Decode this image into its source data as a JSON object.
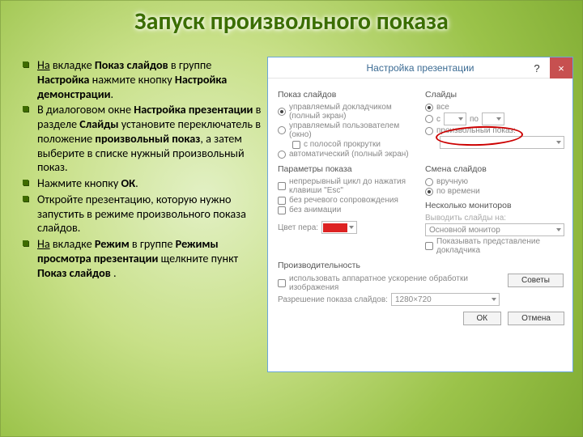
{
  "title": "Запуск произвольного показа",
  "bullets": [
    {
      "pre": "На вкладке ",
      "b1": "Показ слайдов",
      "mid1": " в группе ",
      "b2": "Настройка",
      "mid2": " нажмите кнопку ",
      "b3": "Настройка демонстрации",
      "end": "."
    },
    {
      "pre": "В диалоговом окне ",
      "b1": "Настройка презентации",
      "mid1": " в разделе ",
      "b2": "Слайды",
      "mid2": " установите переключатель в положение ",
      "b3": "произвольный показ",
      "mid3": ", а затем выберите в списке нужный произвольный показ.",
      "end": ""
    },
    {
      "pre": "Нажмите кнопку ",
      "b1": "ОК",
      "end": "."
    },
    {
      "pre": "Откройте презентацию, которую нужно запустить в режиме произвольного показа слайдов.",
      "end": ""
    },
    {
      "pre": "На вкладке ",
      "b1": "Режим",
      "mid1": " в группе ",
      "b2": "Режимы просмотра презентации",
      "mid2": " щелкните пункт ",
      "b3": "Показ слайдов",
      "end": " ."
    }
  ],
  "dialog": {
    "title": "Настройка презентации",
    "help": "?",
    "close": "×",
    "sec_show": "Показ слайдов",
    "r_show1": "управляемый докладчиком (полный экран)",
    "r_show2": "управляемый пользователем (окно)",
    "c_scroll": "с полосой прокрутки",
    "r_show3": "автоматический (полный экран)",
    "sec_slides": "Слайды",
    "r_all": "все",
    "r_from": "с",
    "r_to": "по",
    "r_custom": "произвольный показ:",
    "sec_opts": "Параметры показа",
    "c_loop": "непрерывный цикл до нажатия клавиши \"Esc\"",
    "c_nonarr": "без речевого сопровождения",
    "c_noanim": "без анимации",
    "sec_advance": "Смена слайдов",
    "r_manual": "вручную",
    "r_timing": "по времени",
    "sec_monitors": "Несколько мониторов",
    "l_output": "Выводить слайды на:",
    "sel_monitor": "Основной монитор",
    "c_presenter": "Показывать представление докладчика",
    "l_pen": "Цвет пера:",
    "sec_perf": "Производительность",
    "c_hw": "использовать аппаратное ускорение обработки изображения",
    "btn_tips": "Советы",
    "l_res": "Разрешение показа слайдов:",
    "sel_res": "1280×720",
    "btn_ok": "ОК",
    "btn_cancel": "Отмена"
  }
}
